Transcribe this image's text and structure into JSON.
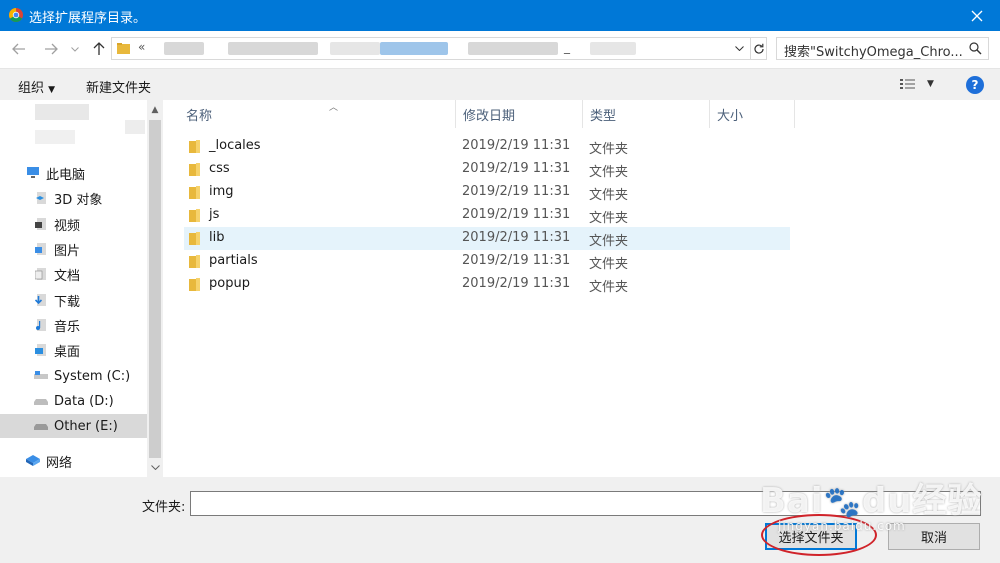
{
  "window": {
    "title": "选择扩展程序目录。",
    "close_icon": "close-icon"
  },
  "address_bar": {
    "prefix": "«",
    "path_visible_suffix": "_"
  },
  "search": {
    "placeholder": "搜索\"SwitchyOmega_Chro..."
  },
  "toolbar": {
    "organize_label": "组织",
    "new_folder_label": "新建文件夹"
  },
  "nav_pane": {
    "items": [
      {
        "label": "此电脑",
        "icon": "computer-icon"
      },
      {
        "label": "3D 对象",
        "icon": "3d-objects-icon"
      },
      {
        "label": "视频",
        "icon": "video-folder-icon"
      },
      {
        "label": "图片",
        "icon": "pictures-folder-icon"
      },
      {
        "label": "文档",
        "icon": "documents-folder-icon"
      },
      {
        "label": "下载",
        "icon": "downloads-folder-icon"
      },
      {
        "label": "音乐",
        "icon": "music-folder-icon"
      },
      {
        "label": "桌面",
        "icon": "desktop-folder-icon"
      },
      {
        "label": "System (C:)",
        "icon": "drive-icon"
      },
      {
        "label": "Data (D:)",
        "icon": "drive-icon"
      },
      {
        "label": "Other (E:)",
        "icon": "drive-icon",
        "selected": true
      },
      {
        "label": "网络",
        "icon": "network-icon"
      }
    ]
  },
  "file_list": {
    "columns": [
      "名称",
      "修改日期",
      "类型",
      "大小"
    ],
    "rows": [
      {
        "name": "_locales",
        "date": "2019/2/19 11:31",
        "type": "文件夹"
      },
      {
        "name": "css",
        "date": "2019/2/19 11:31",
        "type": "文件夹"
      },
      {
        "name": "img",
        "date": "2019/2/19 11:31",
        "type": "文件夹"
      },
      {
        "name": "js",
        "date": "2019/2/19 11:31",
        "type": "文件夹"
      },
      {
        "name": "lib",
        "date": "2019/2/19 11:31",
        "type": "文件夹",
        "selected": true
      },
      {
        "name": "partials",
        "date": "2019/2/19 11:31",
        "type": "文件夹"
      },
      {
        "name": "popup",
        "date": "2019/2/19 11:31",
        "type": "文件夹"
      }
    ]
  },
  "bottom": {
    "folder_label": "文件夹:",
    "folder_value": "",
    "select_button": "选择文件夹",
    "cancel_button": "取消"
  },
  "watermark": {
    "brand": "Baidu经验",
    "url": "jingyan.baidu.com"
  },
  "colors": {
    "titlebar": "#0078d7",
    "selection": "#e5f3fb",
    "folder": "#e8b83c",
    "annotation": "#d0232a"
  }
}
